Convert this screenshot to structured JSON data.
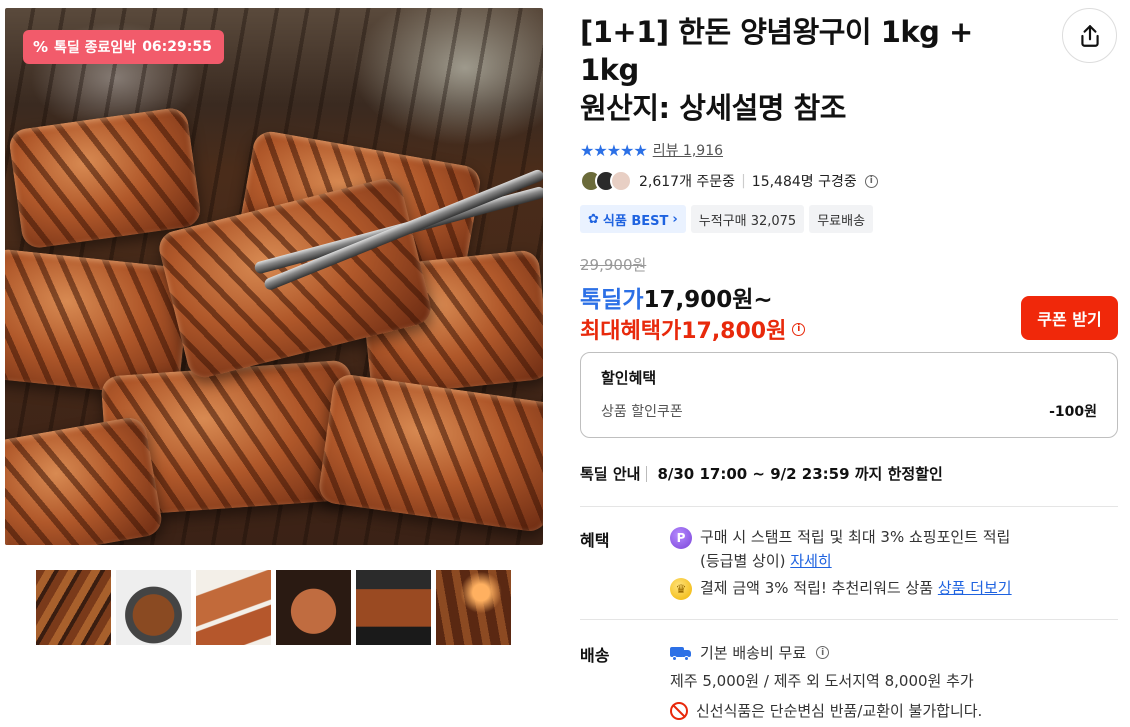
{
  "badge": {
    "label": "톡딜 종료임박",
    "timer": "06:29:55",
    "icon": "percent-icon"
  },
  "product": {
    "title_line1": "[1+1] 한돈 양념왕구이 1kg +",
    "title_line2": "1kg",
    "title_line3": "원산지: 상세설명 참조"
  },
  "rating": {
    "stars": "★★★★★",
    "review_label": "리뷰 1,916"
  },
  "social": {
    "orders": "2,617개 주문중",
    "viewers": "15,484명 구경중"
  },
  "tags": [
    {
      "label": "식품 BEST",
      "icon": "badge-icon",
      "arrow": "›"
    },
    {
      "label": "누적구매 32,075"
    },
    {
      "label": "무료배송"
    }
  ],
  "price": {
    "original": "29,900원",
    "deal_label": "톡딜가",
    "deal_value": "17,900원~",
    "max_label": "최대혜택가",
    "max_value": "17,800원",
    "coupon_button": "쿠폰 받기"
  },
  "discount": {
    "heading": "할인혜택",
    "item_label": "상품 할인쿠폰",
    "item_amount": "-100원"
  },
  "deal_info": {
    "label": "톡딜 안내",
    "text": "8/30 17:00 ~ 9/2 23:59 까지 한정할인"
  },
  "benefits": {
    "label": "혜택",
    "line1a": "구매 시 스탬프 적립 및 최대 3% 쇼핑포인트 적립",
    "line1b": "(등급별 상이)",
    "line1_link": "자세히",
    "line2": "결제 금액 3% 적립! 추천리워드 상품",
    "line2_link": "상품 더보기",
    "coin1": "P"
  },
  "shipping": {
    "label": "배송",
    "line1": "기본 배송비 무료",
    "line2": "제주 5,000원 / 제주 외 도서지역 8,000원 추가",
    "line3": "신선식품은 단순변심 반품/교환이 불가합니다."
  },
  "colors": {
    "accent_blue": "#2c70e6",
    "accent_red": "#f0280a",
    "badge_pink": "#f25b6b"
  }
}
